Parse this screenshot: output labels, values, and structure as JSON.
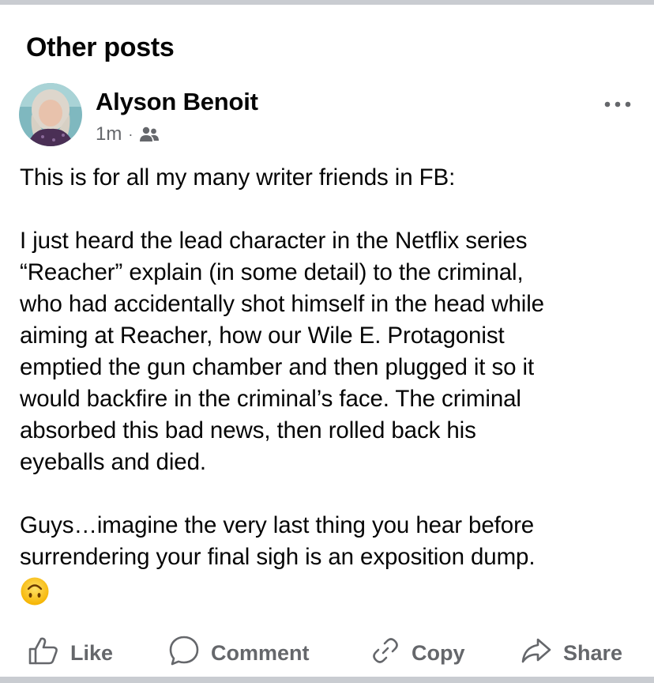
{
  "section": {
    "title": "Other posts"
  },
  "post": {
    "author": "Alyson Benoit",
    "time": "1m",
    "separator": "·",
    "audience_icon": "friends-icon",
    "more_icon": "more-options-icon",
    "paragraphs": [
      "This is for all my many writer friends in FB:",
      "I just heard the lead character in the Netflix series\n“Reacher” explain (in some detail) to the criminal,\nwho had accidentally shot himself in the head while\naiming at Reacher, how our Wile E. Protagonist\nemptied the gun chamber and then plugged it so it\nwould backfire in the criminal’s face. The criminal\nabsorbed this bad news, then rolled back his\neyeballs and died.",
      "Guys…imagine the very last thing you hear before\nsurrendering your final sigh is an exposition dump."
    ],
    "emoji": "upside-down-face-icon"
  },
  "actions": {
    "like": "Like",
    "comment": "Comment",
    "copy": "Copy",
    "share": "Share"
  },
  "colors": {
    "text": "#050505",
    "secondary": "#65676b",
    "divider": "#c9ccd1"
  }
}
